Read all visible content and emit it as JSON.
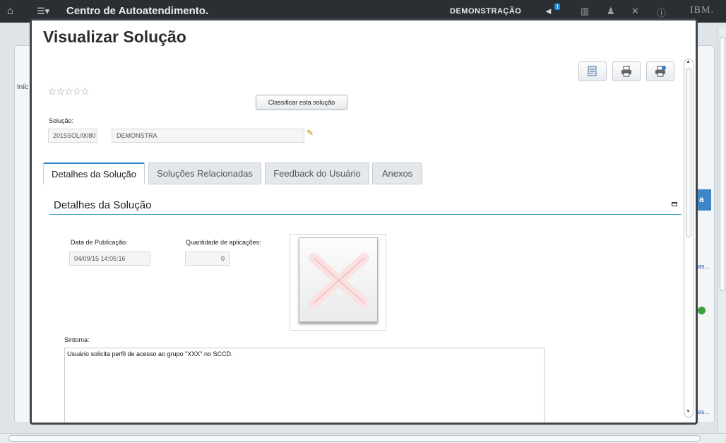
{
  "topbar": {
    "app_title": "Centro de Autoatendimento.",
    "mode": "DEMONSTRAÇÃO",
    "notification_count": "1",
    "brand": "IBM."
  },
  "background": {
    "breadcrumb_start": "Iníc",
    "link_1": "as...",
    "link_2": "es...",
    "blue_tab": "a"
  },
  "modal": {
    "title": "Visualizar Solução",
    "rating_stars": "☆☆☆☆☆",
    "rate_button": "Classificar esta solução",
    "solution_label": "Solução:",
    "solution_id": "2015SOL/0080",
    "solution_desc": "DEMONSTRA",
    "tabs": [
      {
        "label": "Detalhes da Solução"
      },
      {
        "label": "Soluções Relacionadas"
      },
      {
        "label": "Feedback do Usuário"
      },
      {
        "label": "Anexos"
      }
    ],
    "section_title": "Detalhes da Solução",
    "publication_date_label": "Data de Publicação:",
    "publication_date": "04/09/15 14:05:16",
    "applications_count_label": "Quantidade de aplicações:",
    "applications_count": "0",
    "symptom_label": "Sintoma:",
    "symptom_text": "Usuário solicita perfil de acesso ao grupo \"XXX\" no SCCD."
  }
}
